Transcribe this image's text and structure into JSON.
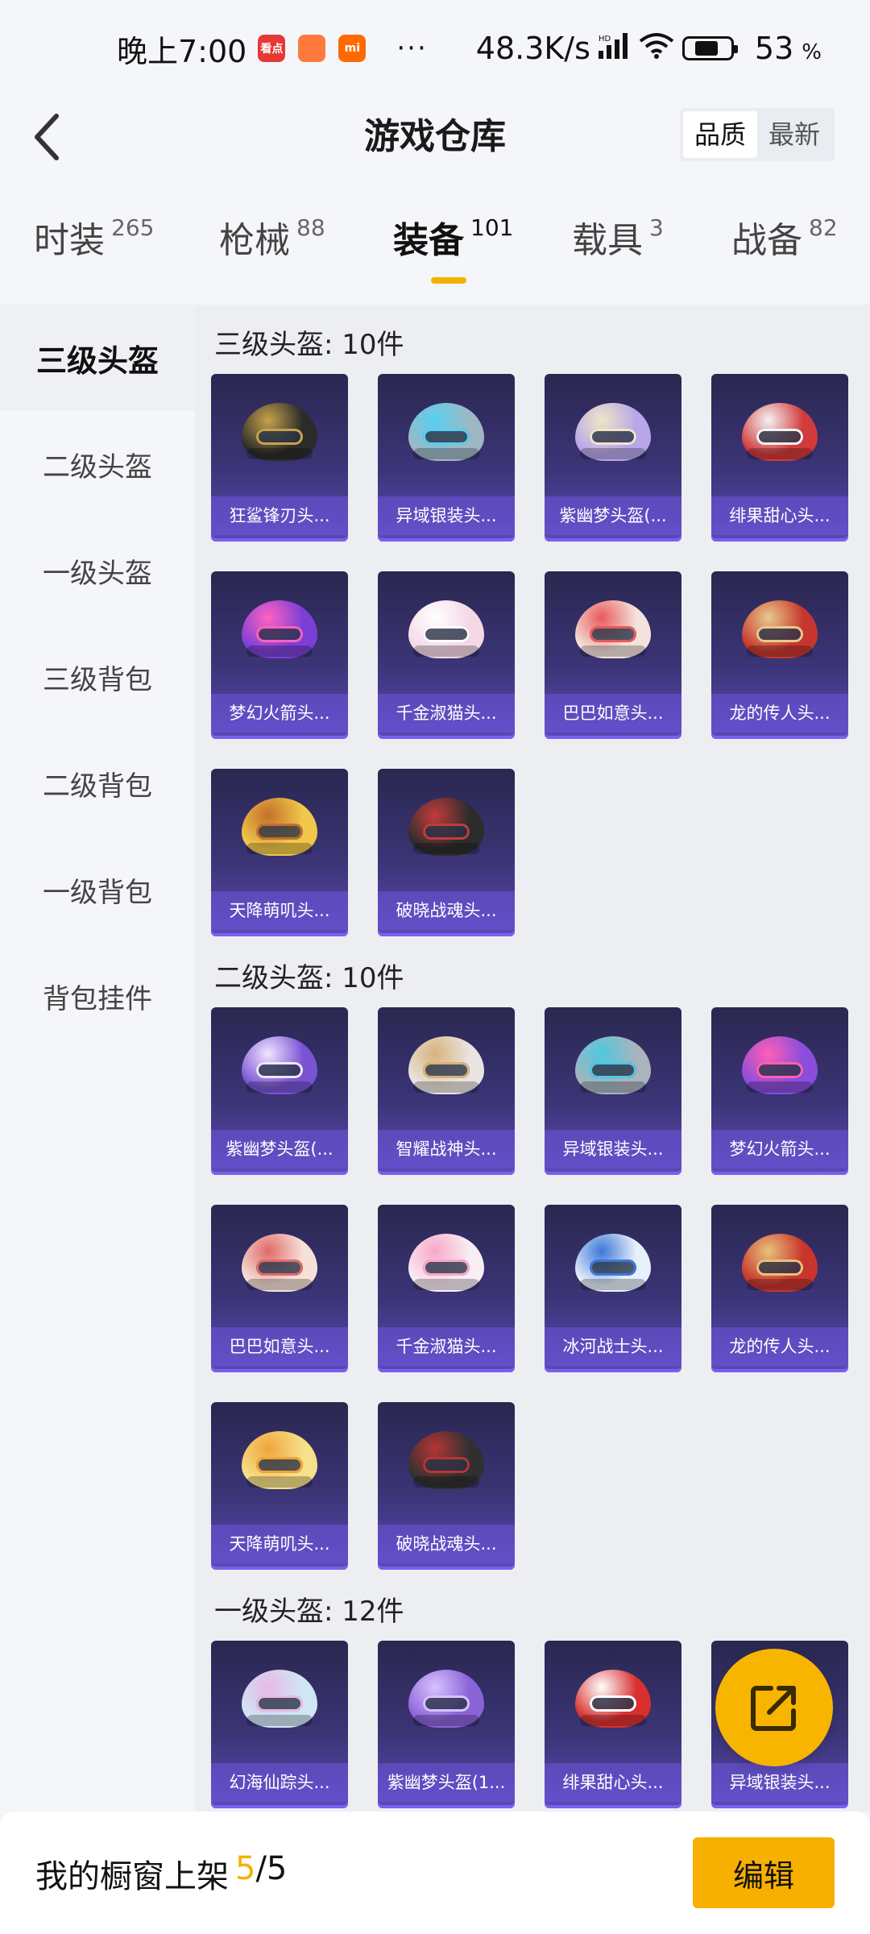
{
  "status_bar": {
    "time": "晚上7:00",
    "app_badges": [
      {
        "label": "看点",
        "color": "#e53935"
      },
      {
        "label": "",
        "color": "#ff7a3d"
      },
      {
        "label": "mi",
        "color": "#ff6a00"
      }
    ],
    "more": "···",
    "net_speed": "48.3K/s",
    "hd": "HD",
    "battery_text": "53",
    "battery_unit": "%",
    "battery_level": 0.53
  },
  "header": {
    "title": "游戏仓库",
    "sort_options": [
      "品质",
      "最新"
    ],
    "active_sort": 0
  },
  "tabs": [
    {
      "label": "时装",
      "count": "265"
    },
    {
      "label": "枪械",
      "count": "88"
    },
    {
      "label": "装备",
      "count": "101"
    },
    {
      "label": "载具",
      "count": "3"
    },
    {
      "label": "战备",
      "count": "82"
    }
  ],
  "sidebar": {
    "items": [
      "三级头盔",
      "二级头盔",
      "一级头盔",
      "三级背包",
      "二级背包",
      "一级背包",
      "背包挂件"
    ]
  },
  "sections": [
    {
      "title": "三级头盔: 10件",
      "items": [
        {
          "name": "狂鲨锋刃头...",
          "color": "#2b2b2b",
          "accent": "#c7a24a"
        },
        {
          "name": "异域银装头...",
          "color": "#9fb7c4",
          "accent": "#56d0f0"
        },
        {
          "name": "紫幽梦头盔(...",
          "color": "#b7a6e8",
          "accent": "#f0e6c8"
        },
        {
          "name": "绯果甜心头...",
          "color": "#d33a3a",
          "accent": "#f3f3f3"
        },
        {
          "name": "梦幻火箭头...",
          "color": "#7b3fd6",
          "accent": "#ff62c0"
        },
        {
          "name": "千金淑猫头...",
          "color": "#f5d8e6",
          "accent": "#ffffff"
        },
        {
          "name": "巴巴如意头...",
          "color": "#f4e3dd",
          "accent": "#e85a5a"
        },
        {
          "name": "龙的传人头...",
          "color": "#c7362e",
          "accent": "#e9c98a"
        },
        {
          "name": "天降萌叽头...",
          "color": "#f0c94a",
          "accent": "#c46f2c"
        },
        {
          "name": "破晓战魂头...",
          "color": "#2c2c2c",
          "accent": "#c33b3b"
        }
      ]
    },
    {
      "title": "二级头盔: 10件",
      "items": [
        {
          "name": "紫幽梦头盔(...",
          "color": "#7a54d4",
          "accent": "#f1e5ff"
        },
        {
          "name": "智耀战神头...",
          "color": "#e9e4e2",
          "accent": "#d9b27a"
        },
        {
          "name": "异域银装头...",
          "color": "#a9b4bd",
          "accent": "#4ec8e0"
        },
        {
          "name": "梦幻火箭头...",
          "color": "#8a4ddc",
          "accent": "#ff5fb3"
        },
        {
          "name": "巴巴如意头...",
          "color": "#f6e1d8",
          "accent": "#e06a6a"
        },
        {
          "name": "千金淑猫头...",
          "color": "#f8eef3",
          "accent": "#f7a8c8"
        },
        {
          "name": "冰河战士头...",
          "color": "#e8f0fb",
          "accent": "#3c78d8"
        },
        {
          "name": "龙的传人头...",
          "color": "#c8352c",
          "accent": "#e8c17a"
        },
        {
          "name": "天降萌叽头...",
          "color": "#f6e08a",
          "accent": "#f0a53a"
        },
        {
          "name": "破晓战魂头...",
          "color": "#303030",
          "accent": "#b53535"
        }
      ]
    },
    {
      "title": "一级头盔: 12件",
      "items": [
        {
          "name": "幻海仙踪头...",
          "color": "#cfe6f5",
          "accent": "#e7b9e6"
        },
        {
          "name": "紫幽梦头盔(1...",
          "color": "#8b63d8",
          "accent": "#d8c2ff"
        },
        {
          "name": "绯果甜心头...",
          "color": "#d8302f",
          "accent": "#ffffff"
        },
        {
          "name": "异域银装头...",
          "color": "#9fb0bc",
          "accent": "#4fc5e4"
        }
      ]
    }
  ],
  "fab": {
    "icon": "share-icon"
  },
  "bottom": {
    "label": "我的橱窗上架",
    "current": "5",
    "total": "/5",
    "edit_label": "编辑"
  }
}
